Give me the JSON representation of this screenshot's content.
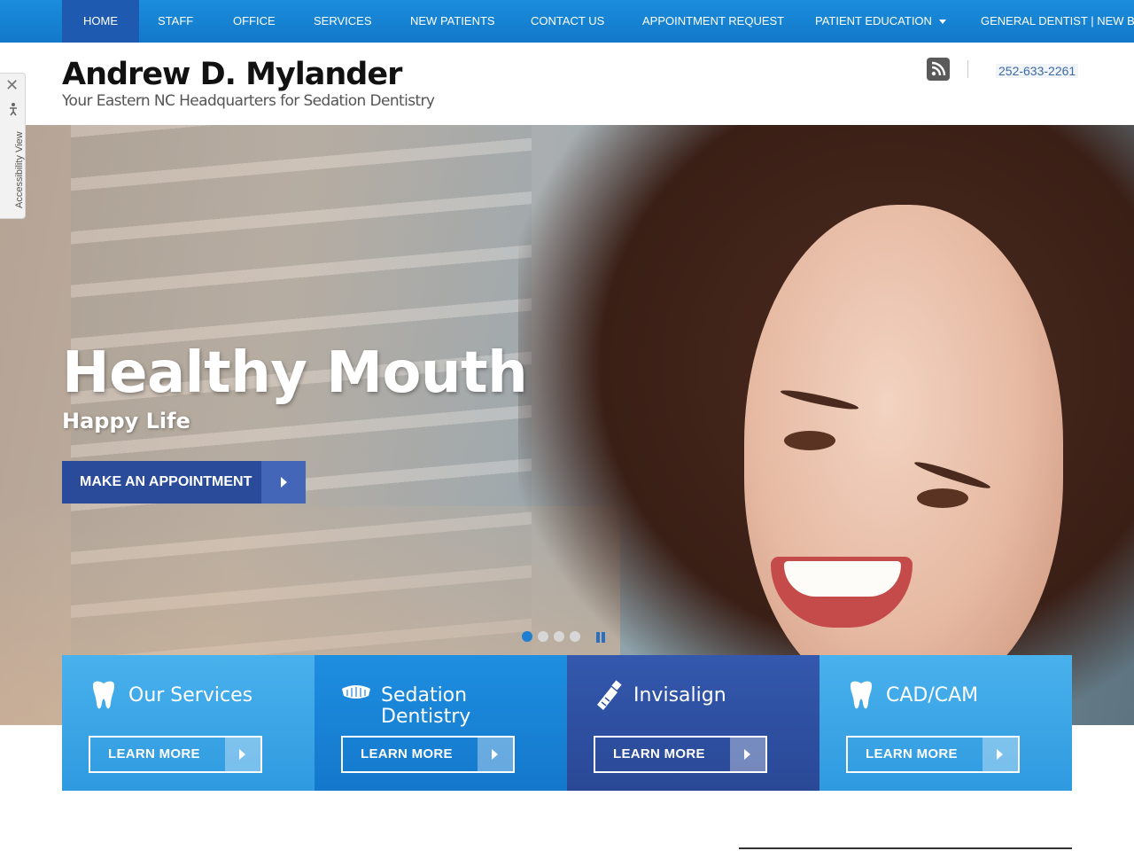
{
  "nav": {
    "items": [
      {
        "label": "HOME",
        "active": true
      },
      {
        "label": "STAFF"
      },
      {
        "label": "OFFICE"
      },
      {
        "label": "SERVICES"
      },
      {
        "label": "NEW PATIENTS"
      },
      {
        "label": "CONTACT US"
      },
      {
        "label": "APPOINTMENT REQUEST"
      },
      {
        "label": "PATIENT EDUCATION"
      },
      {
        "label": "GENERAL DENTIST | NEW BERN"
      }
    ]
  },
  "header": {
    "name": "Andrew D. Mylander",
    "tagline": "Your Eastern NC Headquarters for Sedation Dentistry",
    "phone": "252-633-2261",
    "rss_icon": "rss-icon"
  },
  "accessibility": {
    "label": "Accessibility View",
    "close": "✕"
  },
  "hero": {
    "headline": "Healthy Mouth",
    "subhead": "Happy Life",
    "cta_label": "MAKE AN APPOINTMENT",
    "slides_total": 4,
    "slide_active": 1
  },
  "tiles": [
    {
      "title": "Our Services",
      "button": "LEARN MORE",
      "icon": "tooth-icon",
      "color": "#3aa5e6"
    },
    {
      "title": "Sedation Dentistry",
      "button": "LEARN MORE",
      "icon": "teeth-icon",
      "color": "#1d86d6"
    },
    {
      "title": "Invisalign",
      "button": "LEARN MORE",
      "icon": "toothpaste-icon",
      "color": "#2f4fa1"
    },
    {
      "title": "CAD/CAM",
      "button": "LEARN MORE",
      "icon": "tooth-icon",
      "color": "#3aa5e6"
    }
  ],
  "colors": {
    "nav_bg": "#1a8ddc",
    "nav_active": "#1d5ab0",
    "cta_bg": "#2a4b9a",
    "phone": "#3d6aa3"
  }
}
